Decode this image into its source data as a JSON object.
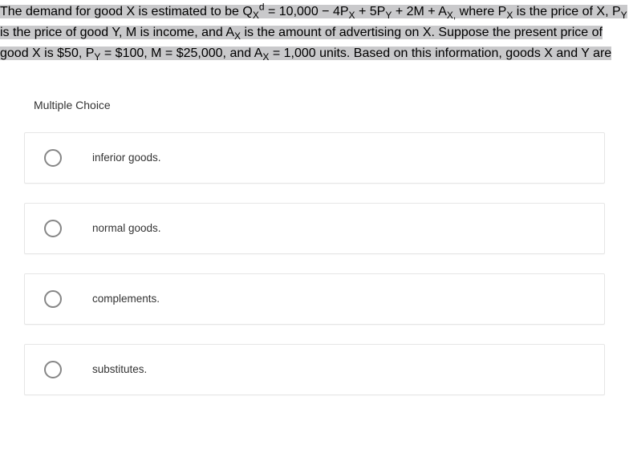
{
  "question": {
    "pre": "The demand for good X is estimated to be Q",
    "sub1": "X",
    "sup1": "d",
    "eq1": " = 10,000 − 4P",
    "subPx": "X",
    "eq2": " + 5P",
    "subPy": "Y",
    "eq3": " + 2M + A",
    "subAx": "X,",
    "eq4": " where P",
    "subPx2": "X",
    "eq5": " is the price of X, P",
    "subPy2": "Y",
    "eq6": " is the price of good Y, M is income, and A",
    "subAx2": "X",
    "eq7": " is the amount of advertising on X. Suppose the present price of good X is $50, P",
    "subPy3": "Y",
    "eq8": " = $100, M = $25,000, and A",
    "subAx3": "X",
    "eq9": " = 1,000 units. Based on this information, goods X and Y are"
  },
  "mc_label": "Multiple Choice",
  "options": [
    {
      "label": "inferior goods."
    },
    {
      "label": "normal goods."
    },
    {
      "label": "complements."
    },
    {
      "label": "substitutes."
    }
  ]
}
